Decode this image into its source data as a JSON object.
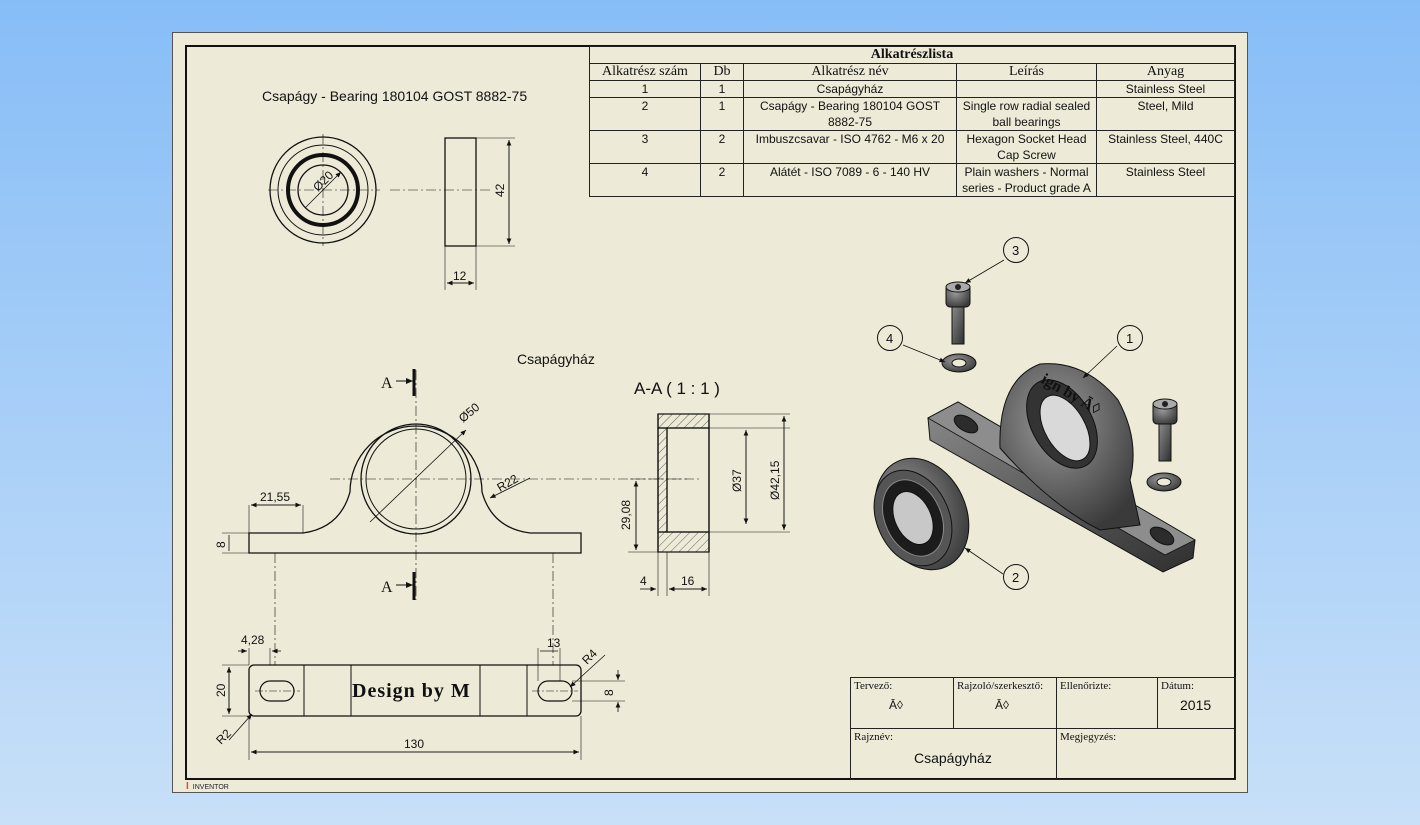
{
  "parts_list": {
    "title": "Alkatrészlista",
    "headers": [
      "Alkatrész szám",
      "Db",
      "Alkatrész név",
      "Leírás",
      "Anyag"
    ],
    "rows": [
      {
        "no": "1",
        "qty": "1",
        "name": "Csapágyház",
        "desc": "",
        "material": "Stainless Steel"
      },
      {
        "no": "2",
        "qty": "1",
        "name": "Csapágy - Bearing 180104 GOST 8882-75",
        "desc": "Single row radial sealed ball bearings",
        "material": "Steel, Mild"
      },
      {
        "no": "3",
        "qty": "2",
        "name": "Imbuszcsavar - ISO 4762 - M6 x 20",
        "desc": "Hexagon Socket Head Cap Screw",
        "material": "Stainless Steel, 440C"
      },
      {
        "no": "4",
        "qty": "2",
        "name": "Alátét - ISO 7089 - 6 - 140 HV",
        "desc": "Plain washers - Normal series - Product grade A",
        "material": "Stainless Steel"
      }
    ]
  },
  "views": {
    "bearing_title": "Csapágy - Bearing 180104 GOST 8882-75",
    "housing_title": "Csapágyház",
    "section_title": "A-A ( 1 : 1 )",
    "section_mark": "A"
  },
  "dimensions": {
    "bearing_bore": "Ø20",
    "bearing_od": "42",
    "bearing_width": "12",
    "housing_bore": "Ø50",
    "housing_radius": "R22",
    "base_offset": "21,55",
    "base_height": "8",
    "center_height": "29,08",
    "sec_inner": "Ø37",
    "sec_outer": "Ø42,15",
    "sec_w1": "4",
    "sec_w2": "16",
    "slot_left": "4,28",
    "slot_right": "13",
    "plan_width": "20",
    "plan_slot": "8",
    "plan_r_left": "R2",
    "plan_r_right": "R4",
    "plan_length": "130"
  },
  "engraving": "Design by M",
  "balloons": [
    "1",
    "2",
    "3",
    "4"
  ],
  "title_block": {
    "designer_label": "Tervező:",
    "designer_value": "Ā◊",
    "drafter_label": "Rajzoló/szerkesztő:",
    "drafter_value": "Ā◊",
    "checked_label": "Ellenőrizte:",
    "date_label": "Dátum:",
    "date_value": "2015",
    "drawing_name_label": "Rajznév:",
    "drawing_name_value": "Csapágyház",
    "notes_label": "Megjegyzés:"
  },
  "app_badge": "INVENTOR"
}
